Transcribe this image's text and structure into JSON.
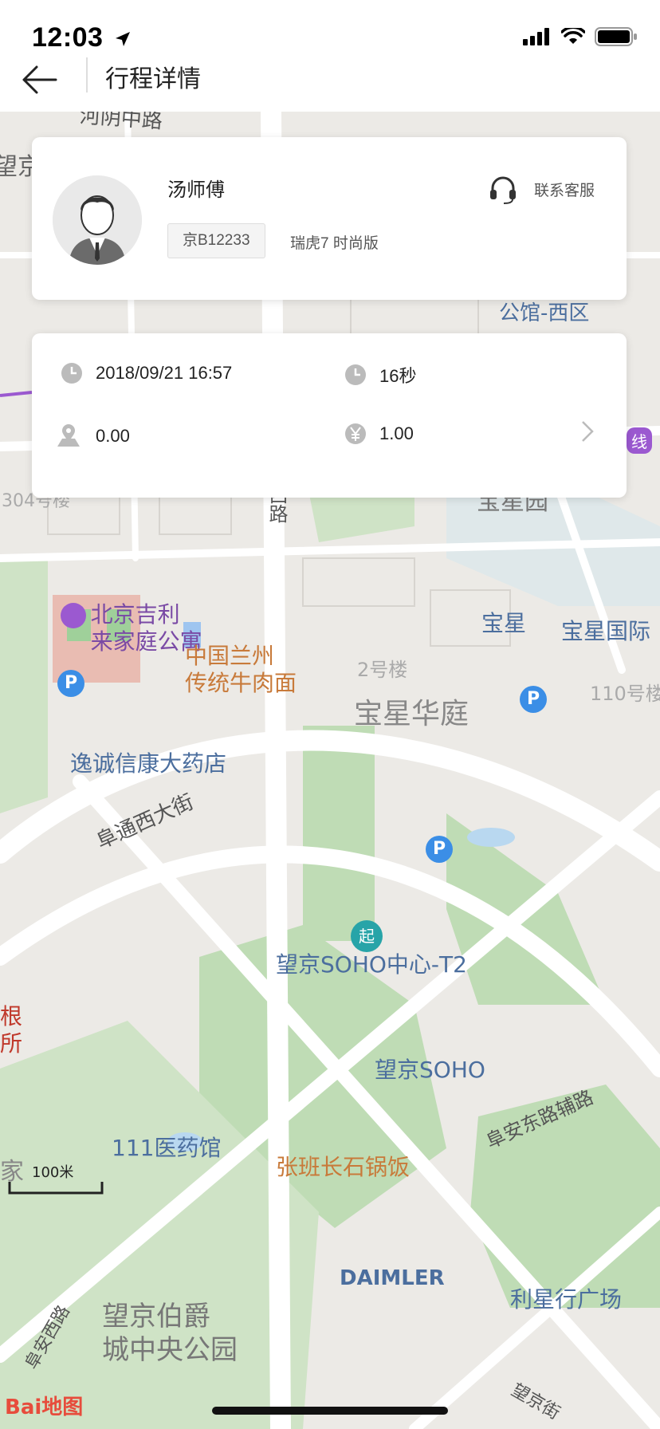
{
  "status": {
    "time": "12:03"
  },
  "nav": {
    "title": "行程详情"
  },
  "driver": {
    "name": "汤师傅",
    "plate": "京B12233",
    "car_model": "瑞虎7 时尚版",
    "service_label": "联系客服"
  },
  "trip": {
    "datetime": "2018/09/21 16:57",
    "duration": "16秒",
    "distance": "0.00",
    "fare": "1.00"
  },
  "map": {
    "labels": {
      "road_top": "河阴中路",
      "wang": "望京",
      "poi_apartment": "北京吉利\n来家庭公寓",
      "poi_lanzhou": "中国兰州\n传统牛肉面",
      "poi_pharmacy": "逸诚信康大药店",
      "road_futong": "阜通西大街",
      "poi_baoxing_garden": "宝星园",
      "poi_baoxing": "宝星",
      "poi_baoxing_intl": "宝星国际",
      "poi_building2": "2号楼",
      "poi_baoxing_huating": "宝星华庭",
      "poi_110": "110号楼",
      "road_fuan": "阜安西路",
      "poi_304": "304号楼",
      "poi_gongguan": "公馆-西区",
      "poi_soho_t2": "望京SOHO中心-T2",
      "start_marker": "起",
      "poi_soho": "望京SOHO",
      "poi_111": "111医药馆",
      "poi_zhangban": "张班长石锅饭",
      "road_fuandong": "阜安东路辅路",
      "poi_daimler": "DAIMLER",
      "poi_lixing": "利星行广场",
      "poi_park": "望京伯爵\n城中央公园",
      "road_fuanxi2": "阜安西路",
      "road_wangjing": "望京街",
      "poi_gen": "根\n所",
      "poi_jia": "家",
      "line_tag": "线",
      "scale": "100米",
      "baidu_logo": "Bai地图"
    },
    "parking_label": "P"
  }
}
